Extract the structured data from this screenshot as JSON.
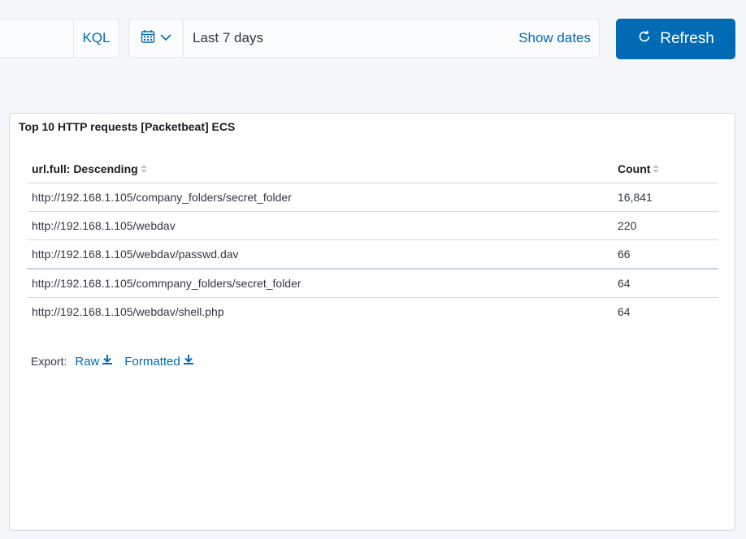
{
  "query_bar": {
    "language_label": "KQL"
  },
  "date_picker": {
    "range_text": "Last 7 days",
    "show_dates_label": "Show dates"
  },
  "refresh": {
    "label": "Refresh"
  },
  "panel": {
    "title": "Top 10 HTTP requests [Packetbeat] ECS",
    "columns": [
      "url.full: Descending",
      "Count"
    ],
    "rows": [
      {
        "url": "http://192.168.1.105/company_folders/secret_folder",
        "count": "16,841"
      },
      {
        "url": "http://192.168.1.105/webdav",
        "count": "220"
      },
      {
        "url": "http://192.168.1.105/webdav/passwd.dav",
        "count": "66"
      },
      {
        "url": "http://192.168.1.105/commpany_folders/secret_folder",
        "count": "64"
      },
      {
        "url": "http://192.168.1.105/webdav/shell.php",
        "count": "64"
      }
    ],
    "export": {
      "label": "Export:",
      "raw_label": "Raw",
      "formatted_label": "Formatted"
    }
  },
  "colors": {
    "accent": "#006bb4",
    "panel_bg": "#ffffff",
    "page_bg": "#f5f7fa"
  },
  "icons": {
    "quick_menu": "calendar-icon",
    "quick_menu_toggle": "chevron-down-icon",
    "refresh": "refresh-icon",
    "sort": "sort-icon",
    "download": "download-icon"
  }
}
